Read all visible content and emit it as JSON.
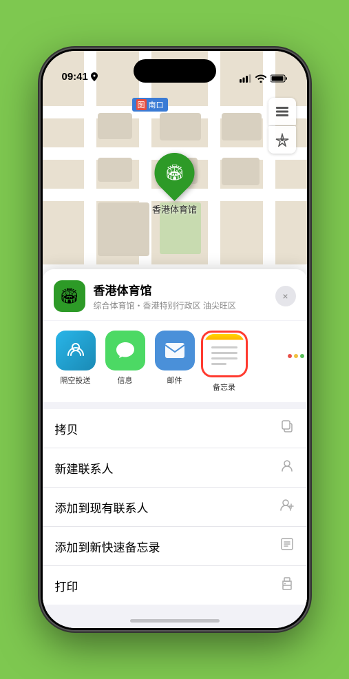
{
  "status_bar": {
    "time": "09:41",
    "location_arrow": true
  },
  "map": {
    "subway_label": "南口",
    "subway_line": "图",
    "pin_label": "香港体育馆"
  },
  "venue_card": {
    "name": "香港体育馆",
    "description": "综合体育馆・香港特别行政区 油尖旺区",
    "close_label": "×"
  },
  "share_apps": [
    {
      "id": "airdrop",
      "label": "隔空投送",
      "type": "airdrop"
    },
    {
      "id": "messages",
      "label": "信息",
      "type": "messages"
    },
    {
      "id": "mail",
      "label": "邮件",
      "type": "mail"
    },
    {
      "id": "notes",
      "label": "备忘录",
      "type": "notes",
      "selected": true
    }
  ],
  "actions": [
    {
      "id": "copy",
      "label": "拷贝",
      "icon": "copy"
    },
    {
      "id": "new-contact",
      "label": "新建联系人",
      "icon": "person"
    },
    {
      "id": "add-existing",
      "label": "添加到现有联系人",
      "icon": "person-add"
    },
    {
      "id": "quick-note",
      "label": "添加到新快速备忘录",
      "icon": "note"
    },
    {
      "id": "print",
      "label": "打印",
      "icon": "print"
    }
  ],
  "colors": {
    "green": "#2d9a27",
    "bg_green": "#7ec850",
    "selected_border": "#ff3b30"
  }
}
